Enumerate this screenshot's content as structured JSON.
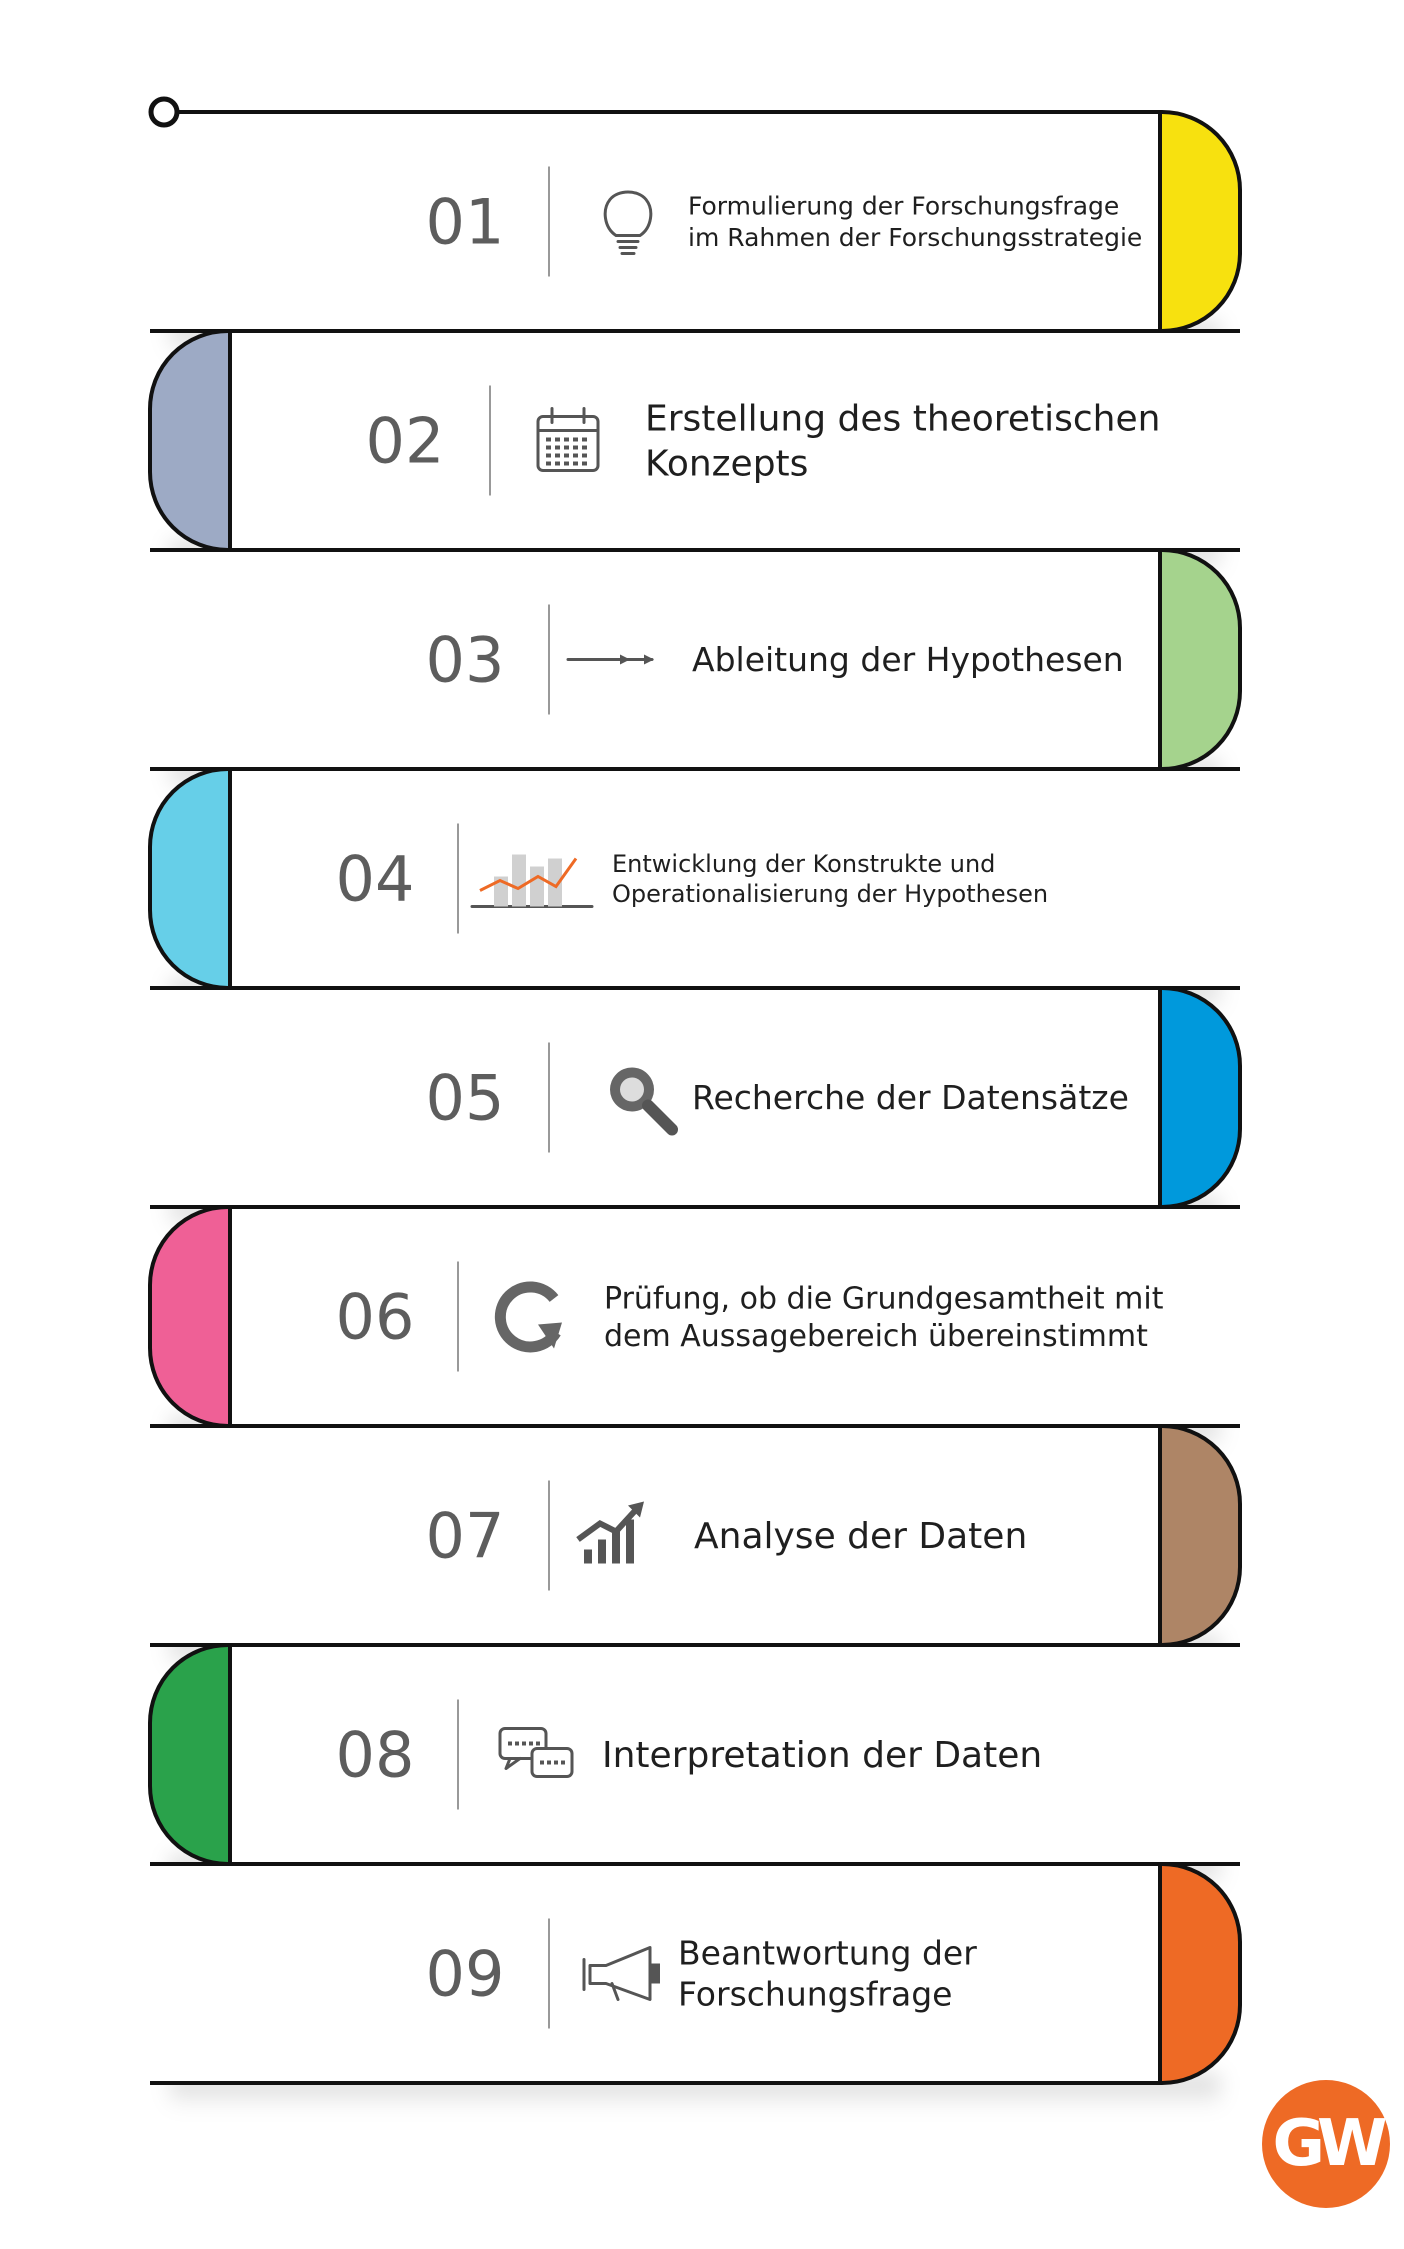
{
  "steps": [
    {
      "number": "01",
      "lines": [
        "Formulierung der Forschungsfrage",
        "im Rahmen der Forschungsstrategie"
      ],
      "color": "#f7e10f",
      "icon": "lightbulb-icon"
    },
    {
      "number": "02",
      "lines": [
        "Erstellung des theoretischen",
        "Konzepts"
      ],
      "color": "#9daac5",
      "icon": "calendar-icon"
    },
    {
      "number": "03",
      "lines": [
        "Ableitung der Hypothesen"
      ],
      "color": "#a5d38d",
      "icon": "arrow-icon"
    },
    {
      "number": "04",
      "lines": [
        "Entwicklung der Konstrukte und",
        "Operationalisierung der Hypothesen"
      ],
      "color": "#66cfe8",
      "icon": "bar-chart-icon"
    },
    {
      "number": "05",
      "lines": [
        "Recherche der Datensätze"
      ],
      "color": "#0099dc",
      "icon": "magnifier-icon"
    },
    {
      "number": "06",
      "lines": [
        "Prüfung, ob die Grundgesamtheit mit",
        "dem Aussagebereich übereinstimmt"
      ],
      "color": "#ef6096",
      "icon": "refresh-icon"
    },
    {
      "number": "07",
      "lines": [
        "Analyse der Daten"
      ],
      "color": "#ae8566",
      "icon": "growth-chart-icon"
    },
    {
      "number": "08",
      "lines": [
        "Interpretation der Daten"
      ],
      "color": "#2aa24b",
      "icon": "chat-bubbles-icon"
    },
    {
      "number": "09",
      "lines": [
        "Beantwortung der",
        "Forschungsfrage"
      ],
      "color": "#ee6a25",
      "icon": "megaphone-icon"
    }
  ],
  "logo": {
    "text": "GW",
    "color": "#ee6a25"
  }
}
